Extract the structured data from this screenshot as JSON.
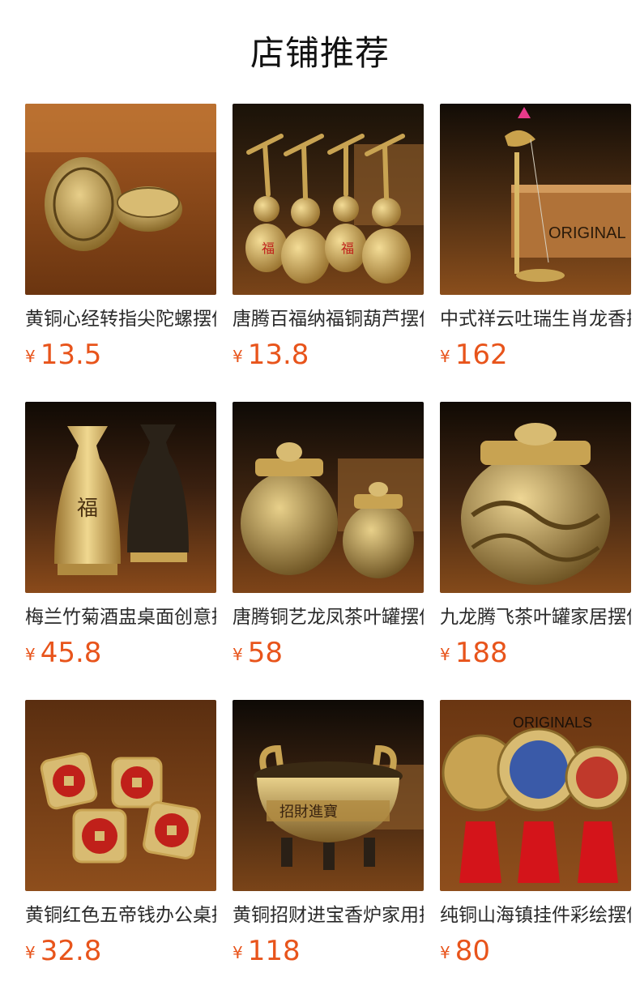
{
  "header": {
    "title": "店铺推荐"
  },
  "colors": {
    "price": "#e8541b",
    "title": "#111111"
  },
  "products": [
    {
      "name": "黄铜心经转指尖陀螺摆件",
      "currency": "¥",
      "price": "13.5",
      "image": "brass-spinner-photo"
    },
    {
      "name": "唐腾百福纳福铜葫芦摆件",
      "currency": "¥",
      "price": "13.8",
      "image": "brass-gourd-photo"
    },
    {
      "name": "中式祥云吐瑞生肖龙香插",
      "currency": "¥",
      "price": "162",
      "image": "incense-holder-photo"
    },
    {
      "name": "梅兰竹菊酒盅桌面创意摆件",
      "currency": "¥",
      "price": "45.8",
      "image": "wine-vase-photo"
    },
    {
      "name": "唐腾铜艺龙凤茶叶罐摆件",
      "currency": "¥",
      "price": "58",
      "image": "tea-jar-photo"
    },
    {
      "name": "九龙腾飞茶叶罐家居摆件",
      "currency": "¥",
      "price": "188",
      "image": "dragon-jar-photo"
    },
    {
      "name": "黄铜红色五帝钱办公桌摆件",
      "currency": "¥",
      "price": "32.8",
      "image": "coin-dice-photo"
    },
    {
      "name": "黄铜招财进宝香炉家用摆件",
      "currency": "¥",
      "price": "118",
      "image": "incense-burner-photo"
    },
    {
      "name": "纯铜山海镇挂件彩绘摆件",
      "currency": "¥",
      "price": "80",
      "image": "hanging-medallion-photo"
    }
  ]
}
